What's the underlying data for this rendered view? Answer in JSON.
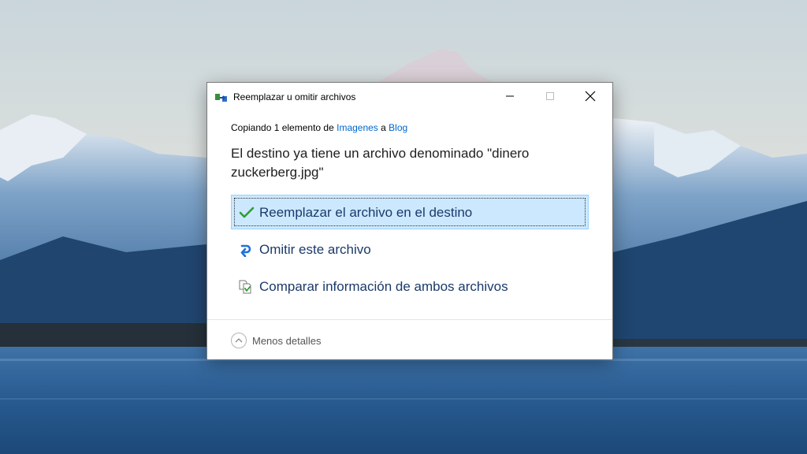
{
  "dialog": {
    "title": "Reemplazar u omitir archivos",
    "subtitle": {
      "prefix": "Copiando 1 elemento de ",
      "source": "Imagenes",
      "middle": " a ",
      "destination": "Blog"
    },
    "heading": "El destino ya tiene un archivo denominado \"dinero zuckerberg.jpg\"",
    "options": [
      {
        "label": "Reemplazar el archivo en el destino",
        "icon": "checkmark-icon",
        "selected": true
      },
      {
        "label": "Omitir este archivo",
        "icon": "skip-arrow-icon",
        "selected": false
      },
      {
        "label": "Comparar información de ambos archivos",
        "icon": "compare-files-icon",
        "selected": false
      }
    ],
    "details_toggle": "Menos detalles"
  },
  "colors": {
    "link": "#0066cc",
    "selected_bg": "#cce8ff",
    "checkmark": "#2e9f2e",
    "skip_arrow": "#1e73d8"
  }
}
